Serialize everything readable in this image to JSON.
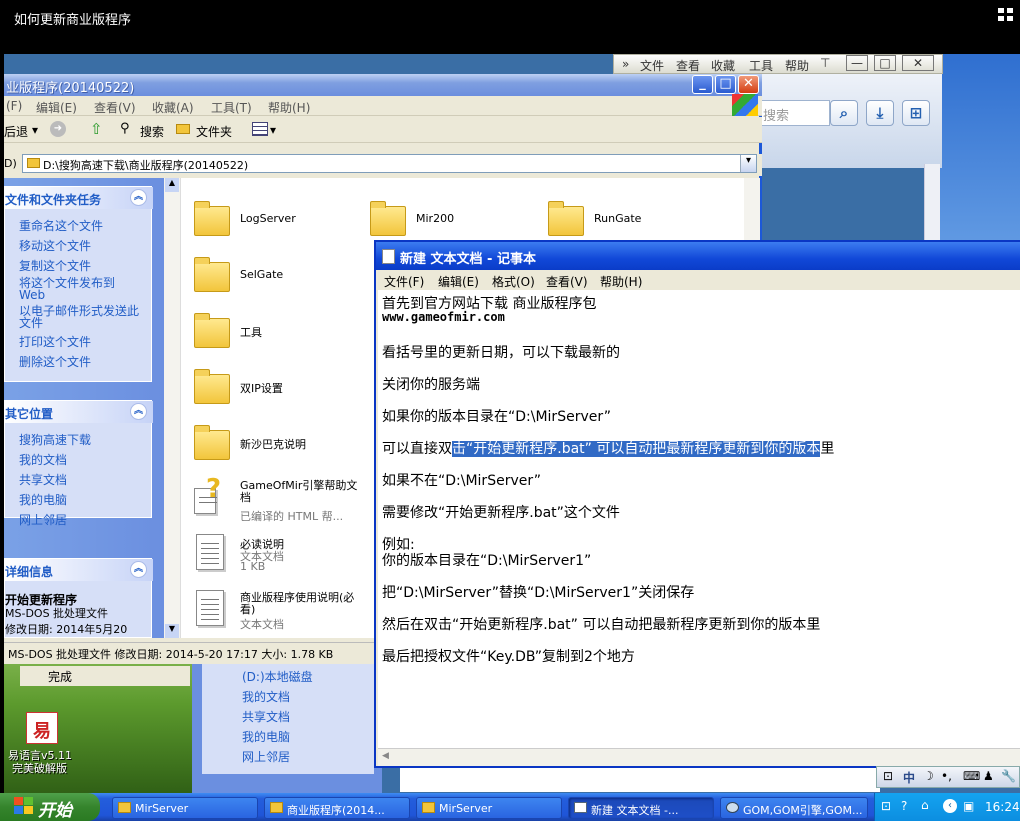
{
  "player": {
    "title": "如何更新商业版程序"
  },
  "ie": {
    "menu": [
      "文件",
      "查看",
      "收藏",
      "工具",
      "帮助"
    ],
    "search_placeholder": "搜索"
  },
  "explorer": {
    "title": "业版程序(20140522)",
    "menu": [
      "(F)",
      "编辑(E)",
      "查看(V)",
      "收藏(A)",
      "工具(T)",
      "帮助(H)"
    ],
    "toolbar": {
      "back": "后退",
      "search": "搜索",
      "folders": "文件夹"
    },
    "address_label": "D)",
    "address": "D:\\搜狗高速下载\\商业版程序(20140522)",
    "tasks": {
      "file_tasks_title": "文件和文件夹任务",
      "file_tasks": [
        "重命名这个文件",
        "移动这个文件",
        "复制这个文件",
        "将这个文件发布到Web",
        "以电子邮件形式发送此文件",
        "打印这个文件",
        "删除这个文件"
      ],
      "other_places_title": "其它位置",
      "other_places": [
        "搜狗高速下载",
        "我的文档",
        "共享文档",
        "我的电脑",
        "网上邻居"
      ],
      "details_title": "详细信息",
      "details_name": "开始更新程序",
      "details_type": "MS-DOS 批处理文件",
      "details_date": "修改日期: 2014年5月20"
    },
    "files": [
      {
        "name": "LogServer"
      },
      {
        "name": "Mir200"
      },
      {
        "name": "RunGate"
      },
      {
        "name": "SelGate"
      },
      {
        "name": "工具"
      },
      {
        "name": "双IP设置"
      },
      {
        "name": "新沙巴克说明"
      },
      {
        "name": "GameOfMir引擎帮助文档",
        "sub": "已编译的 HTML 帮..."
      },
      {
        "name": "必读说明",
        "sub": "文本文档",
        "sub2": "1 KB"
      },
      {
        "name": "商业版程序使用说明(必看)",
        "sub": "文本文档"
      }
    ],
    "status": "MS-DOS 批处理文件 修改日期: 2014-5-20 17:17 大小: 1.78 KB"
  },
  "explorer2": {
    "status": "完成",
    "links": [
      "(D:)本地磁盘",
      "我的文档",
      "共享文档",
      "我的电脑",
      "网上邻居"
    ]
  },
  "desktop_icon": {
    "label1": "易语言v5.11",
    "label2": "完美破解版"
  },
  "notepad": {
    "title": "新建 文本文档 - 记事本",
    "menu": [
      "文件(F)",
      "编辑(E)",
      "格式(O)",
      "查看(V)",
      "帮助(H)"
    ],
    "lines": [
      "首先到官方网站下载 商业版程序包",
      "www.gameofmir.com",
      "看括号里的更新日期，可以下载最新的",
      "关闭你的服务端",
      "如果你的版本目录在“D:\\MirServer”",
      "如果不在“D:\\MirServer”",
      "需要修改“开始更新程序.bat”这个文件",
      "例如:",
      "你的版本目录在“D:\\MirServer1”",
      "把“D:\\MirServer”替换“D:\\MirServer1”关闭保存",
      "然后在双击“开始更新程序.bat” 可以自动把最新程序更新到你的版本里",
      "最后把授权文件“Key.DB”复制到2个地方"
    ],
    "sel_line_prefix": "可以直接双",
    "sel_line_selected": "击“开始更新程序.bat” 可以自动把最新程序更新到你的版本",
    "sel_line_suffix": "里"
  },
  "taskbar": {
    "start": "开始",
    "items": [
      "MirServer",
      "商业版程序(2014...",
      "MirServer",
      "新建 文本文档 -...",
      "GOM,GOM引擎,GOM..."
    ],
    "time": "16:24",
    "ime": "中"
  }
}
